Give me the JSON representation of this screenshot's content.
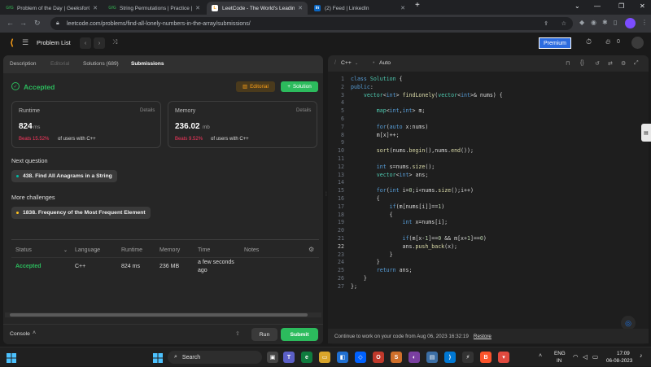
{
  "browser": {
    "tabs": [
      {
        "title": "Problem of the Day | GeeksforGe",
        "icon": "gfg-icon"
      },
      {
        "title": "String Permutations | Practice | G",
        "icon": "gfg-icon"
      },
      {
        "title": "LeetCode - The World's Leading",
        "icon": "leetcode-icon"
      },
      {
        "title": "(2) Feed | LinkedIn",
        "icon": "linkedin-icon"
      }
    ],
    "new_tab": "+",
    "url": "leetcode.com/problems/find-all-lonely-numbers-in-the-array/submissions/"
  },
  "header": {
    "problem_list": "Problem List",
    "premium": "Premium",
    "streak_count": "0"
  },
  "left": {
    "tabs": [
      "Description",
      "Editorial",
      "Solutions (689)",
      "Submissions"
    ],
    "status": "Accepted",
    "editorial_btn": "Editorial",
    "solution_btn": "Solution",
    "runtime": {
      "label": "Runtime",
      "details": "Details",
      "value": "824",
      "unit": "ms",
      "beats": "Beats 15.52%",
      "suffix": "of users with C++"
    },
    "memory": {
      "label": "Memory",
      "details": "Details",
      "value": "236.02",
      "unit": "mb",
      "beats": "Beats 9.52%",
      "suffix": "of users with C++"
    },
    "next_question_title": "Next question",
    "next_question": "438. Find All Anagrams in a String",
    "more_challenges_title": "More challenges",
    "challenge": "1838. Frequency of the Most Frequent Element",
    "table": {
      "headers": [
        "Status",
        "Language",
        "Runtime",
        "Memory",
        "Time",
        "Notes"
      ],
      "row": [
        "Accepted",
        "C++",
        "824 ms",
        "236 MB",
        "a few seconds",
        "ago"
      ]
    },
    "console": "Console",
    "run": "Run",
    "submit": "Submit"
  },
  "editor": {
    "language": "C++",
    "mode": "Auto",
    "restore_text": "Continue to work on your code from Aug 06, 2023 16:32:19",
    "restore_link": "Restore"
  },
  "code_lines": [
    "class Solution {",
    "public:",
    "    vector<int> findLonely(vector<int>& nums) {",
    "",
    "        map<int,int> m;",
    "",
    "        for(auto x:nums)",
    "        m[x]++;",
    "",
    "        sort(nums.begin(),nums.end());",
    "",
    "        int s=nums.size();",
    "        vector<int> ans;",
    "",
    "        for(int i=0;i<nums.size();i++)",
    "        {",
    "            if(m[nums[i]]==1)",
    "            {",
    "                int x=nums[i];",
    "",
    "                if(m[x-1]==0 && m[x+1]==0)",
    "                ans.push_back(x);",
    "            }",
    "        }",
    "        return ans;",
    "    }",
    "};"
  ],
  "taskbar": {
    "search": "Search",
    "lang": "ENG",
    "region": "IN",
    "time": "17:09",
    "date": "06-08-2023"
  },
  "colors": {
    "accepted": "#2cbb5d",
    "beats": "#ff375f",
    "editorial": "#ffa116",
    "submit": "#2cbb5d"
  }
}
